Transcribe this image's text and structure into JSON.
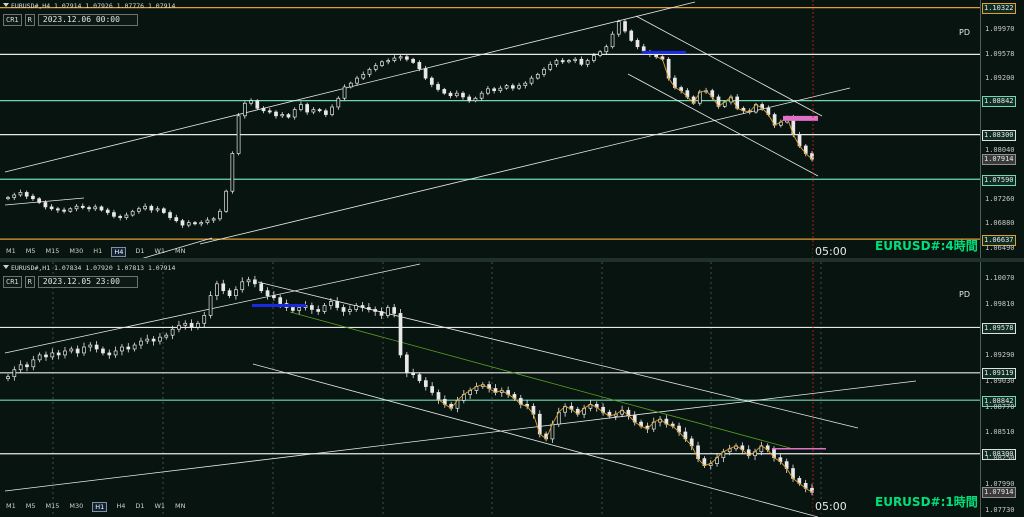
{
  "pane1": {
    "header_text": "EURUSD#,H4  1.07914 1.07926 1.07776 1.07914",
    "cr_label": "CR1",
    "r_label": "R",
    "date_text": "2023.12.06 00:00",
    "pd_label": "PD",
    "symbol_label": "EURUSD#:4時間",
    "time_label": "05:00",
    "timeframes": [
      "M1",
      "M5",
      "M15",
      "M30",
      "H1",
      "H4",
      "D1",
      "W1",
      "MN"
    ],
    "active_timeframe": "H4",
    "axis": {
      "ticks": [
        "1.10322",
        "1.09970",
        "1.09578",
        "1.09200",
        "1.08842",
        "1.08300",
        "1.08040",
        "1.07914",
        "1.07590",
        "1.07260",
        "1.06880",
        "1.06637",
        "1.06490"
      ],
      "boxed": {
        "1.10322": "orange",
        "1.08842": "green",
        "1.08300": "white",
        "1.07914": "cur",
        "1.07590": "green",
        "1.06637": "orange"
      }
    },
    "levels": [
      {
        "price": 1.10322,
        "color": "#e0a030"
      },
      {
        "price": 1.09578,
        "color": "#e8e8e8"
      },
      {
        "price": 1.08842,
        "color": "#70d8b0"
      },
      {
        "price": 1.083,
        "color": "#e8e8e8"
      },
      {
        "price": 1.0759,
        "color": "#70d8b0"
      },
      {
        "price": 1.06637,
        "color": "#e0a030"
      }
    ],
    "price_range": [
      1.064,
      1.1038
    ],
    "candles": [
      1.073,
      1.0734,
      1.0738,
      1.0732,
      1.0728,
      1.0722,
      1.0715,
      1.0712,
      1.071,
      1.0708,
      1.0712,
      1.0716,
      1.0714,
      1.0712,
      1.0715,
      1.071,
      1.0706,
      1.07,
      1.0698,
      1.0702,
      1.0708,
      1.0712,
      1.0716,
      1.071,
      1.0712,
      1.0706,
      1.0698,
      1.0693,
      1.0686,
      1.069,
      1.0688,
      1.069,
      1.0694,
      1.0696,
      1.0708,
      1.074,
      1.08,
      1.086,
      1.088,
      1.0884,
      1.0872,
      1.0868,
      1.0866,
      1.086,
      1.0862,
      1.0858,
      1.087,
      1.0878,
      1.0866,
      1.087,
      1.0868,
      1.0862,
      1.0874,
      1.0888,
      1.0906,
      1.0912,
      1.092,
      1.0926,
      1.0934,
      1.094,
      1.0946,
      1.0948,
      1.0952,
      1.0954,
      1.095,
      1.0945,
      1.0935,
      1.092,
      1.091,
      1.0902,
      1.0896,
      1.0892,
      1.0896,
      1.089,
      1.0884,
      1.0888,
      1.0896,
      1.0903,
      1.09,
      1.0904,
      1.0908,
      1.0904,
      1.0908,
      1.0912,
      1.092,
      1.0926,
      1.0934,
      1.0942,
      1.0948,
      1.0946,
      1.0948,
      1.095,
      1.0942,
      1.0948,
      1.0956,
      1.0962,
      1.097,
      1.099,
      1.101,
      1.0995,
      1.098,
      1.097,
      1.0962,
      1.0958,
      1.0954,
      1.095,
      1.092,
      1.0905,
      1.09,
      1.089,
      1.088,
      1.0898,
      1.09,
      1.089,
      1.0875,
      1.0882,
      1.089,
      1.0872,
      1.0868,
      1.0866,
      1.0878,
      1.0872,
      1.0862,
      1.0845,
      1.085,
      1.0858,
      1.083,
      1.0812,
      1.08,
      1.0791
    ],
    "pd_line": {
      "price": 1.0856,
      "color": "#e070c8"
    },
    "blue_line": {
      "price": 1.0961,
      "color": "#1a2ae0"
    }
  },
  "pane2": {
    "header_text": "EURUSD#,H1  1.07834 1.07920 1.07813 1.07914",
    "cr_label": "CR1",
    "r_label": "R",
    "date_text": "2023.12.05 23:00",
    "pd_label": "PD",
    "symbol_label": "EURUSD#:1時間",
    "time_label": "05:00",
    "timeframes": [
      "M1",
      "M5",
      "M15",
      "M30",
      "H1",
      "H4",
      "D1",
      "W1",
      "MN"
    ],
    "active_timeframe": "H1",
    "axis": {
      "ticks": [
        "1.10070",
        "1.09810",
        "1.09578",
        "1.09290",
        "1.09119",
        "1.09030",
        "1.08842",
        "1.08770",
        "1.08510",
        "1.08300",
        "1.08250",
        "1.07990",
        "1.07914",
        "1.07730"
      ],
      "boxed": {
        "1.09578": "white",
        "1.09119": "white",
        "1.08842": "green",
        "1.08300": "white",
        "1.07914": "cur"
      }
    },
    "levels": [
      {
        "price": 1.09578,
        "color": "#e8e8e8"
      },
      {
        "price": 1.09119,
        "color": "#e8e8e8"
      },
      {
        "price": 1.08842,
        "color": "#70d8b0"
      },
      {
        "price": 1.083,
        "color": "#e8e8e8"
      }
    ],
    "price_range": [
      1.077,
      1.102
    ],
    "candles": [
      1.0908,
      1.0915,
      1.092,
      1.0918,
      1.0925,
      1.093,
      1.0928,
      1.0932,
      1.093,
      1.0934,
      1.0936,
      1.0932,
      1.0938,
      1.094,
      1.0936,
      1.0932,
      1.093,
      1.0934,
      1.0938,
      1.0936,
      1.094,
      1.0944,
      1.0946,
      1.0944,
      1.0948,
      1.095,
      1.0956,
      1.096,
      1.0962,
      1.0958,
      1.0962,
      1.097,
      1.099,
      1.1002,
      1.0995,
      1.099,
      1.0996,
      1.1004,
      1.1006,
      1.1002,
      1.0995,
      1.099,
      1.0988,
      1.0982,
      1.0978,
      1.0975,
      1.0978,
      1.098,
      1.0976,
      1.0974,
      1.098,
      1.0984,
      1.0978,
      1.0974,
      1.0976,
      1.098,
      1.0978,
      1.0976,
      1.0974,
      1.097,
      1.0978,
      1.0972,
      1.093,
      1.0912,
      1.091,
      1.0904,
      1.0898,
      1.0892,
      1.0885,
      1.088,
      1.0876,
      1.0884,
      1.089,
      1.0894,
      1.0898,
      1.09,
      1.0896,
      1.0892,
      1.0894,
      1.089,
      1.0886,
      1.088,
      1.0878,
      1.087,
      1.085,
      1.0845,
      1.086,
      1.0872,
      1.0878,
      1.0875,
      1.087,
      1.0876,
      1.088,
      1.0877,
      1.0872,
      1.0868,
      1.087,
      1.0874,
      1.0869,
      1.0862,
      1.0858,
      1.0855,
      1.0862,
      1.0865,
      1.086,
      1.0858,
      1.0852,
      1.0845,
      1.0838,
      1.0825,
      1.0818,
      1.082,
      1.0826,
      1.0832,
      1.0835,
      1.0838,
      1.0834,
      1.0828,
      1.0832,
      1.0838,
      1.0834,
      1.0826,
      1.0822,
      1.0815,
      1.0805,
      1.08,
      1.0795,
      1.0791
    ],
    "pd_line": {
      "price": 1.0835,
      "color": "#e070c8"
    },
    "blue_line": {
      "price": 1.098,
      "color": "#1a2ae0"
    }
  }
}
